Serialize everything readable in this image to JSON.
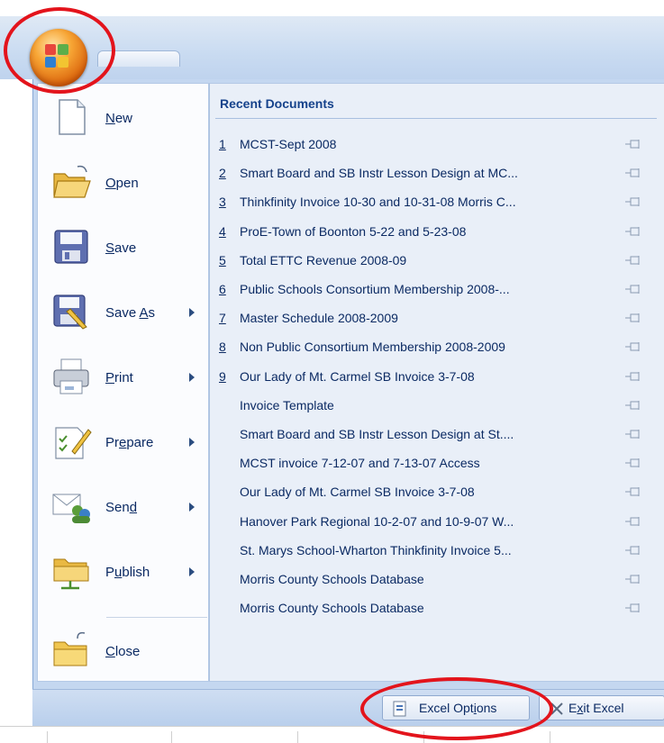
{
  "menu": {
    "items": [
      {
        "label": "New",
        "accel": "N",
        "rest": "ew",
        "icon": "new-document-icon",
        "submenu": false
      },
      {
        "label": "Open",
        "accel": "O",
        "rest": "pen",
        "icon": "open-folder-icon",
        "submenu": false
      },
      {
        "label": "Save",
        "accel": "S",
        "rest": "ave",
        "icon": "save-disk-icon",
        "submenu": false
      },
      {
        "label": "Save As",
        "accel": "A",
        "pre": "Save ",
        "rest": "s",
        "icon": "save-as-icon",
        "submenu": true
      },
      {
        "label": "Print",
        "accel": "P",
        "rest": "rint",
        "icon": "printer-icon",
        "submenu": true
      },
      {
        "label": "Prepare",
        "accel": "e",
        "pre": "Pr",
        "rest": "pare",
        "icon": "prepare-icon",
        "submenu": true
      },
      {
        "label": "Send",
        "accel": "d",
        "pre": "Sen",
        "rest": "",
        "icon": "send-icon",
        "submenu": true
      },
      {
        "label": "Publish",
        "accel": "u",
        "pre": "P",
        "rest": "blish",
        "icon": "publish-icon",
        "submenu": true
      },
      {
        "label": "Close",
        "accel": "C",
        "rest": "lose",
        "icon": "close-folder-icon",
        "submenu": false
      }
    ]
  },
  "recent": {
    "header": "Recent Documents",
    "documents": [
      {
        "num": "1",
        "name": "MCST-Sept 2008"
      },
      {
        "num": "2",
        "name": "Smart Board and SB Instr Lesson Design at MC..."
      },
      {
        "num": "3",
        "name": "Thinkfinity Invoice 10-30 and 10-31-08 Morris C..."
      },
      {
        "num": "4",
        "name": "ProE-Town of Boonton 5-22 and 5-23-08"
      },
      {
        "num": "5",
        "name": "Total ETTC Revenue 2008-09"
      },
      {
        "num": "6",
        "name": "Public Schools Consortium Membership 2008-..."
      },
      {
        "num": "7",
        "name": "Master Schedule 2008-2009"
      },
      {
        "num": "8",
        "name": "Non Public Consortium Membership 2008-2009"
      },
      {
        "num": "9",
        "name": "Our Lady of Mt. Carmel SB Invoice 3-7-08"
      },
      {
        "num": "",
        "name": "Invoice Template"
      },
      {
        "num": "",
        "name": "Smart Board and SB Instr Lesson Design at St...."
      },
      {
        "num": "",
        "name": "MCST invoice 7-12-07 and 7-13-07 Access"
      },
      {
        "num": "",
        "name": "Our Lady of Mt. Carmel SB Invoice 3-7-08"
      },
      {
        "num": "",
        "name": "Hanover Park Regional 10-2-07 and 10-9-07 W..."
      },
      {
        "num": "",
        "name": "St. Marys School-Wharton Thinkfinity Invoice 5..."
      },
      {
        "num": "",
        "name": "Morris County Schools Database"
      },
      {
        "num": "",
        "name": "Morris County Schools Database"
      }
    ]
  },
  "footer": {
    "options_pre": "Excel Opt",
    "options_accel": "i",
    "options_post": "ons",
    "exit_pre": "E",
    "exit_accel": "x",
    "exit_post": "it Excel"
  },
  "colors": {
    "annotation": "#e3141c",
    "menu_text": "#0b2a63",
    "panel_bg": "#c4d7f0"
  }
}
